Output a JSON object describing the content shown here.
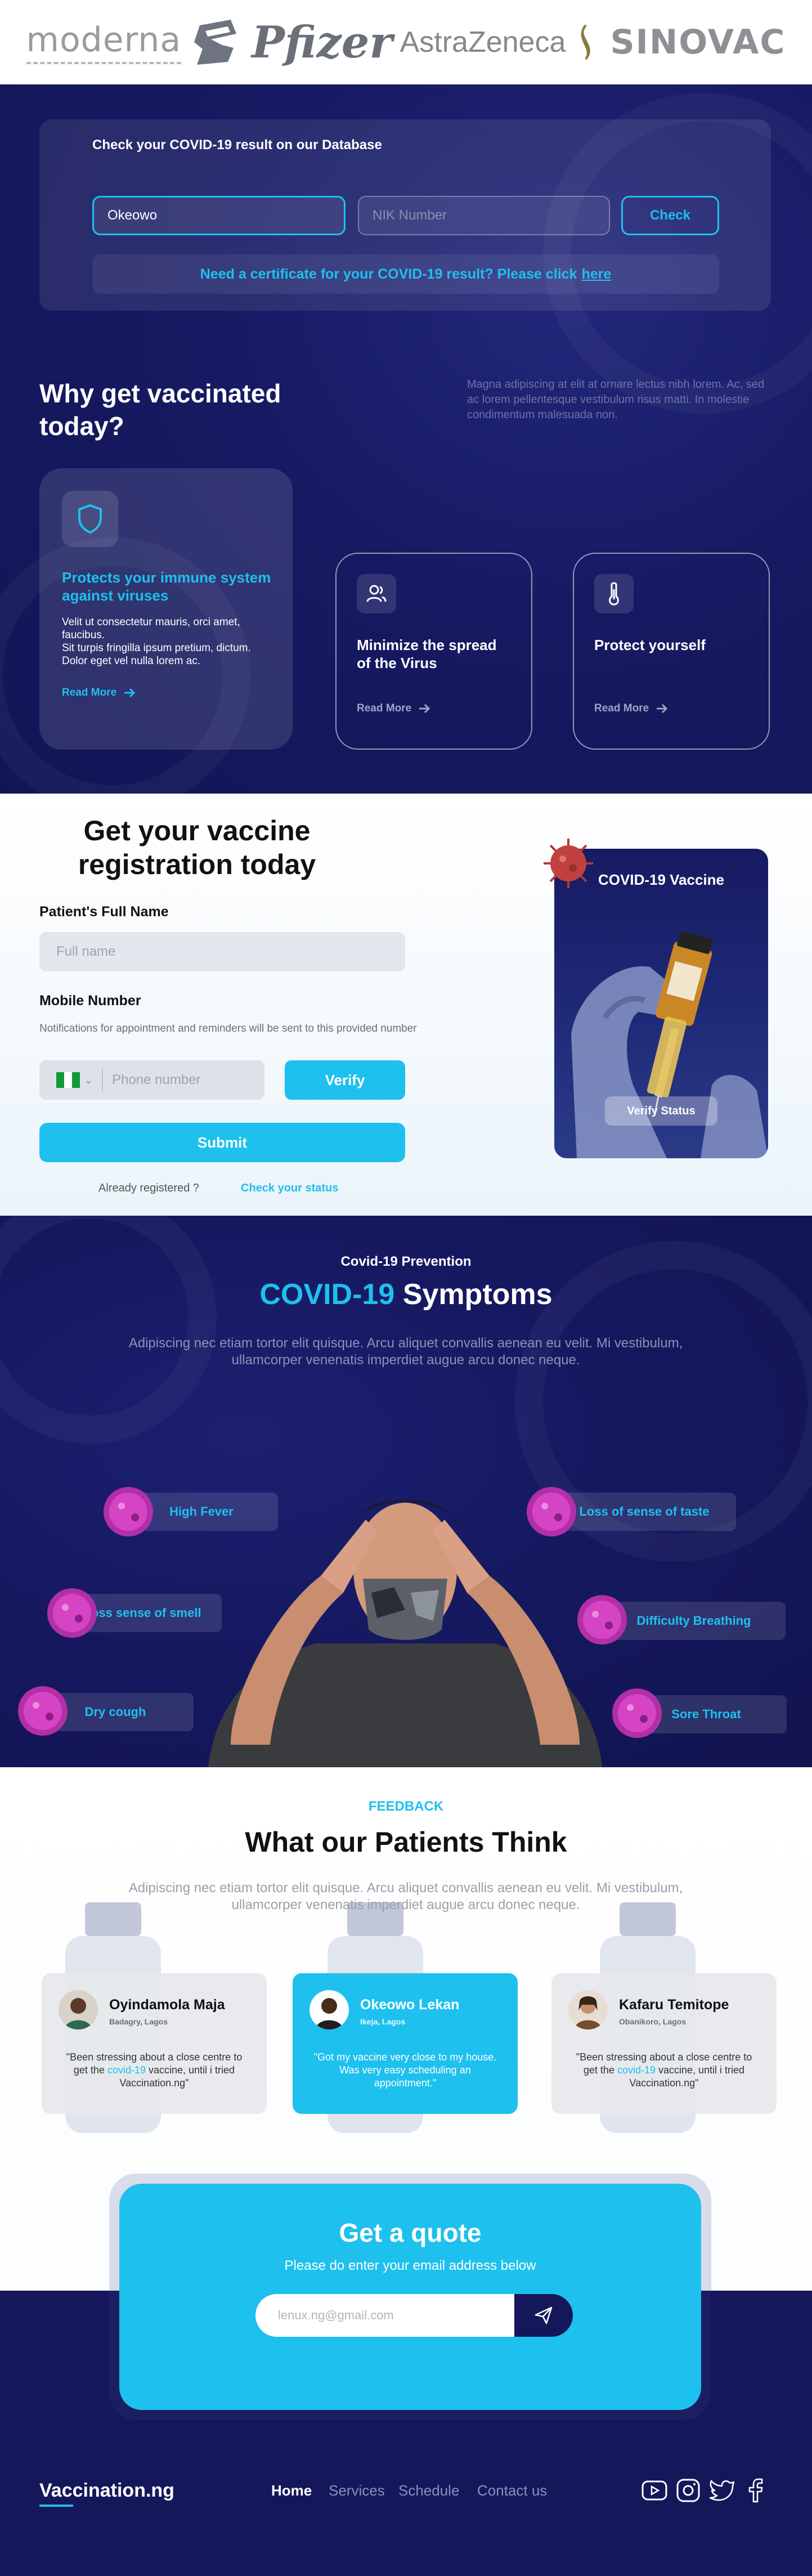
{
  "partners": [
    "moderna",
    "Pfizer",
    "AstraZeneca",
    "SINOVAC"
  ],
  "check": {
    "title": "Check your COVID-19 result on our Database",
    "name_value": "Okeowo",
    "nik_placeholder": "NIK Number",
    "check_label": "Check",
    "cert_text": "Need a certificate for your COVID-19 result? Please click",
    "cert_link": "here"
  },
  "why": {
    "title": "Why get vaccinated today?",
    "description": "Magna adipiscing at elit at ornare lectus nibh lorem. Ac, sed ac lorem pellentesque vestibulum risus matti. In molestie condimentum malesuada non.",
    "cards": [
      {
        "title": "Protects your immune system against viruses",
        "body": "Velit ut consectetur mauris, orci amet, faucibus.\nSit turpis fringilla ipsum pretium, dictum. Dolor eget vel nulla lorem ac.",
        "more": "Read More",
        "icon": "shield-icon"
      },
      {
        "title": "Minimize the spread of the Virus",
        "more": "Read More",
        "icon": "users-icon"
      },
      {
        "title": "Protect yourself",
        "more": "Read More",
        "icon": "thermometer-icon"
      }
    ]
  },
  "registration": {
    "title": "Get your vaccine registration today",
    "name_label": "Patient's Full Name",
    "name_placeholder": "Full name",
    "mobile_label": "Mobile Number",
    "mobile_note": "Notifications for appointment and reminders will be sent to this provided number",
    "phone_placeholder": "Phone number",
    "verify_label": "Verify",
    "submit_label": "Submit",
    "already_text": "Already registered ?",
    "status_link": "Check your status",
    "card_title": "COVID-19 Vaccine",
    "card_button": "Verify Status"
  },
  "symptoms": {
    "kicker": "Covid-19 Prevention",
    "title_highlight": "COVID-19",
    "title_rest": "Symptoms",
    "description": "Adipiscing nec etiam tortor elit quisque. Arcu aliquet convallis aenean eu velit. Mi vestibulum, ullamcorper venenatis imperdiet augue arcu donec neque.",
    "items": [
      "High Fever",
      "Loss sense of smell",
      "Dry cough",
      "Loss of sense of taste",
      "Difficulty Breathing",
      "Sore Throat"
    ]
  },
  "feedback": {
    "kicker": "FEEDBACK",
    "title": "What our Patients Think",
    "description": "Adipiscing nec etiam tortor elit quisque. Arcu aliquet convallis aenean eu velit. Mi vestibulum, ullamcorper venenatis imperdiet augue arcu donec neque.",
    "testimonials": [
      {
        "name": "Oyindamola Maja",
        "location": "Badagry, Lagos",
        "quote_pre": "\"Been stressing about a close centre to get the ",
        "quote_hl": "covid-19",
        "quote_post": " vaccine, until i tried Vaccination.ng\""
      },
      {
        "name": "Okeowo Lekan",
        "location": "Ikeja, Lagos",
        "quote": "\"Got my vaccine very close to my house. Was very easy scheduling an appointment.\""
      },
      {
        "name": "Kafaru Temitope",
        "location": "Obanikoro, Lagos",
        "quote_pre": "\"Been stressing about a close centre to get the ",
        "quote_hl": "covid-19",
        "quote_post": " vaccine, until i tried Vaccination.ng\""
      }
    ]
  },
  "quote": {
    "title": "Get a quote",
    "subtitle": "Please do enter your email address below",
    "email_placeholder": "lenux.ng@gmail.com"
  },
  "footer": {
    "brand": "Vaccination.ng",
    "nav": [
      "Home",
      "Services",
      "Schedule",
      "Contact us"
    ],
    "social": [
      "youtube-icon",
      "instagram-icon",
      "twitter-icon",
      "facebook-icon"
    ]
  },
  "colors": {
    "navy": "#14175a",
    "accent": "#1ec0ee",
    "virus": "#c42bb0"
  }
}
